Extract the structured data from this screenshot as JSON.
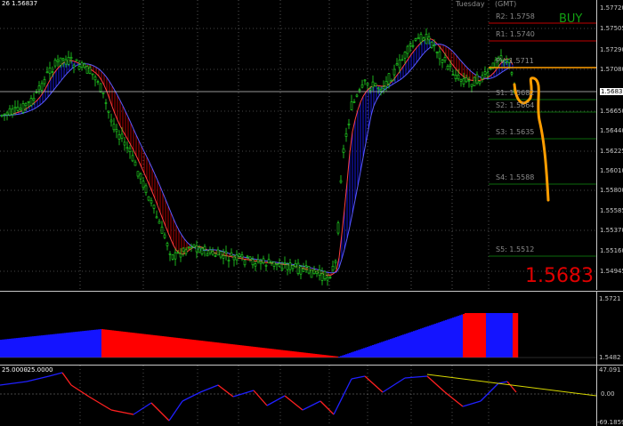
{
  "header": {
    "symbol_text": "26 1.56837",
    "day_label": "Tuesday",
    "tz_label": "(GMT)"
  },
  "signal": {
    "label": "BUY",
    "color": "#12a012"
  },
  "current_price": {
    "main": "1.5683",
    "sub": "7",
    "line_label": "1.56837"
  },
  "pivot_levels": [
    {
      "name": "R2",
      "value": "1.5758",
      "text": "R2: 1.5758",
      "color": "#c00000"
    },
    {
      "name": "R1",
      "value": "1.5740",
      "text": "R1: 1.5740",
      "color": "#c00000"
    },
    {
      "name": "PV",
      "value": "1.5711",
      "text": "PV: 1.5711",
      "color": "#ff9d00"
    },
    {
      "name": "S1",
      "value": "1.5682",
      "text": "S1: 1.5682",
      "color": "#0c6a0c"
    },
    {
      "name": "S2",
      "value": "1.5664",
      "text": "S2: 1.5664",
      "color": "#0c6a0c"
    },
    {
      "name": "S3",
      "value": "1.5635",
      "text": "S3: 1.5635",
      "color": "#0c6a0c"
    },
    {
      "name": "S4",
      "value": "1.5588",
      "text": "S4: 1.5588",
      "color": "#0c6a0c"
    },
    {
      "name": "S5",
      "value": "1.5512",
      "text": "S5: 1.5512",
      "color": "#0c6a0c"
    }
  ],
  "price_axis": [
    "1.57720",
    "1.57505",
    "1.57290",
    "1.57080",
    "1.56837",
    "1.56650",
    "1.56440",
    "1.56225",
    "1.56010",
    "1.55800",
    "1.55585",
    "1.55370",
    "1.55160",
    "1.54945",
    "1.54730",
    "1.54520"
  ],
  "indicator1": {
    "axis_top": "1.5721",
    "axis_bottom": "1.5482",
    "bull_color": "#1414ff",
    "bear_color": "#ff0000"
  },
  "indicator2": {
    "label_left": "25.0000",
    "label_right": "-25.0000",
    "axis_top": "47.091",
    "axis_mid": "0.00",
    "axis_bottom": "-69.1859"
  },
  "colors": {
    "candles": "#22dd22",
    "band_bull": "#1a1aff",
    "band_bear": "#cc0000",
    "annotation": "#ff9d00",
    "grid": "#ffffff"
  }
}
